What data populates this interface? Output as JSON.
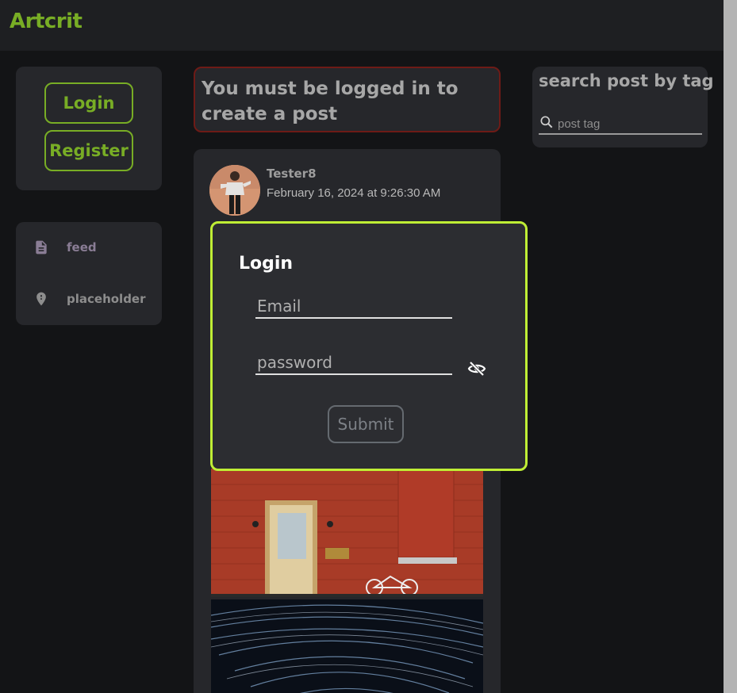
{
  "header": {
    "logo": "Artcrit"
  },
  "auth": {
    "login_label": "Login",
    "register_label": "Register"
  },
  "nav": {
    "items": [
      {
        "label": "feed",
        "icon": "document-icon"
      },
      {
        "label": "placeholder",
        "icon": "location-pin-icon"
      }
    ]
  },
  "notice": {
    "text": "You must be logged in to create a post"
  },
  "post": {
    "username": "Tester8",
    "date": "February 16, 2024 at 9:26:30 AM"
  },
  "search": {
    "title": "search post by tag",
    "placeholder": "post tag"
  },
  "login_modal": {
    "title": "Login",
    "email_placeholder": "Email",
    "password_placeholder": "password",
    "submit_label": "Submit"
  },
  "colors": {
    "accent": "#78ad25",
    "modal_border": "#bfee35",
    "notice_border": "#6e1b17"
  }
}
